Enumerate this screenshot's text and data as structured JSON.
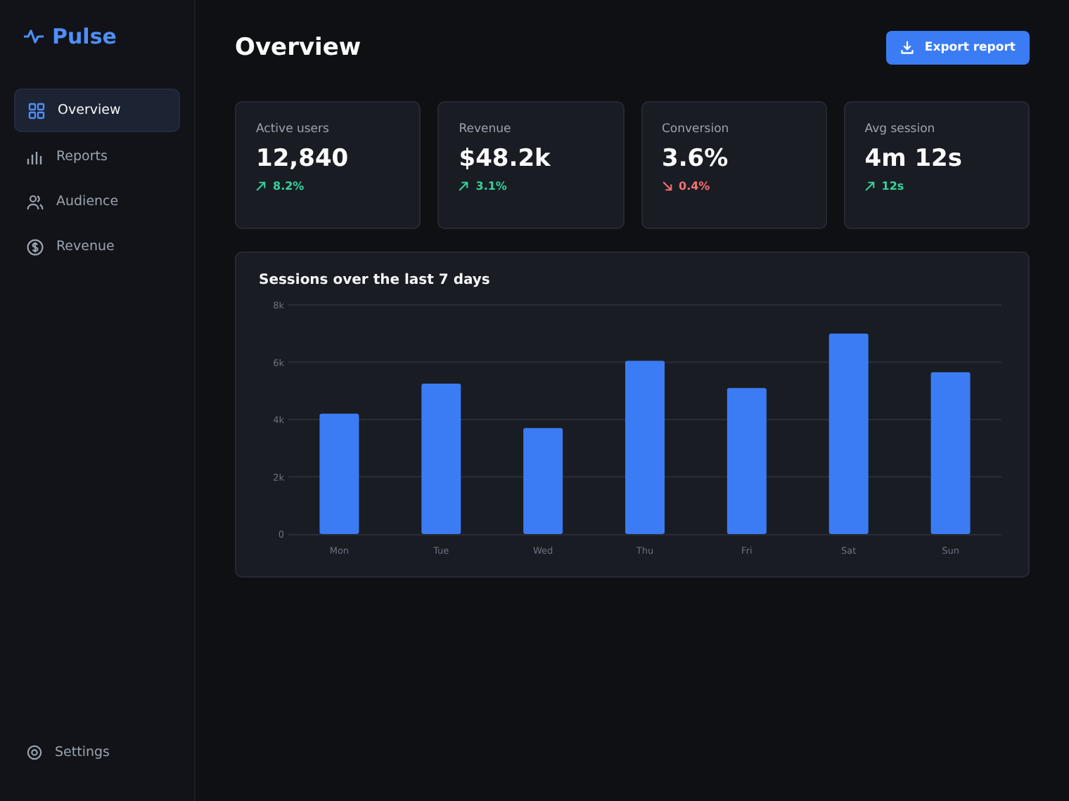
{
  "brand": {
    "name": "Pulse"
  },
  "nav": [
    {
      "label": "Overview",
      "selected": true
    },
    {
      "label": "Reports",
      "selected": false
    },
    {
      "label": "Audience",
      "selected": false
    },
    {
      "label": "Revenue",
      "selected": false
    }
  ],
  "settings": {
    "label": "Settings"
  },
  "header": {
    "title": "Overview",
    "action": "Export report"
  },
  "stats": [
    {
      "label": "Active users",
      "value": "12,840",
      "change": "8.2%",
      "kind": "up"
    },
    {
      "label": "Revenue",
      "value": "$48.2k",
      "change": "3.1%",
      "kind": "up"
    },
    {
      "label": "Conversion",
      "value": "3.6%",
      "change": "0.4%",
      "kind": "down"
    },
    {
      "label": "Avg session",
      "value": "4m 12s",
      "change": "12s",
      "kind": "up"
    }
  ],
  "chart": {
    "title": "Sessions over the last 7 days",
    "chart_data": {
      "type": "bar",
      "categories": [
        "Mon",
        "Tue",
        "Wed",
        "Thu",
        "Fri",
        "Sat",
        "Sun"
      ],
      "grid": true,
      "series": [
        {
          "color": "#3b7cf4",
          "values": [
            4200,
            5250,
            3700,
            6050,
            5100,
            7000,
            5650
          ]
        }
      ],
      "ylim": [
        0,
        8000
      ],
      "yticks": [
        {
          "value": 0,
          "label": "0"
        },
        {
          "value": 2000,
          "label": "2k"
        },
        {
          "value": 4000,
          "label": "4k"
        },
        {
          "value": 6000,
          "label": "6k"
        },
        {
          "value": 8000,
          "label": "8k"
        }
      ]
    }
  }
}
